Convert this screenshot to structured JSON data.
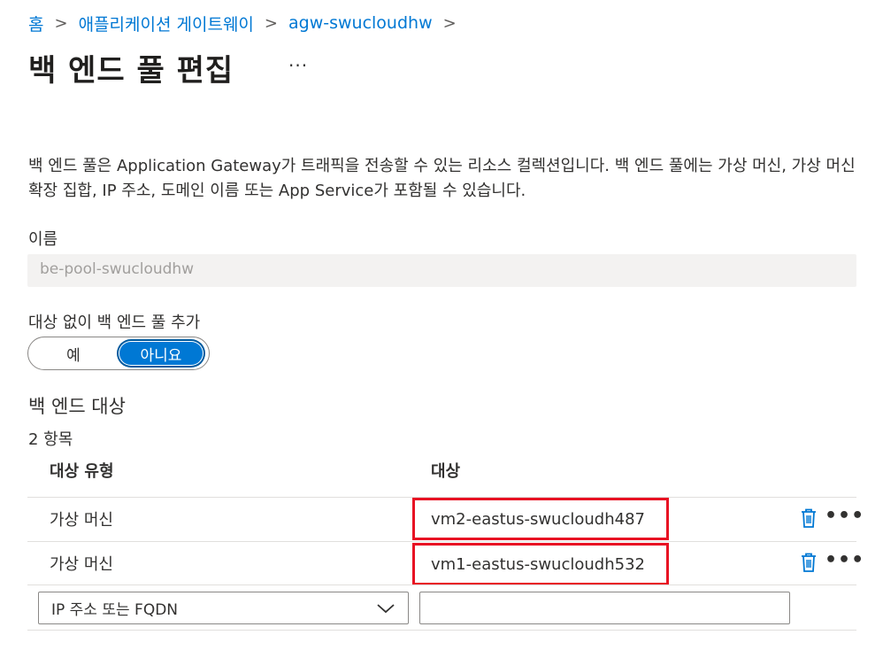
{
  "breadcrumb": {
    "items": [
      "홈",
      "애플리케이션 게이트웨이",
      "agw-swucloudhw"
    ],
    "separator": ">"
  },
  "page": {
    "title": "백 엔드 풀 편집",
    "more_label": "···"
  },
  "description": "백 엔드 풀은 Application Gateway가 트래픽을 전송할 수 있는 리소스 컬렉션입니다. 백 엔드 풀에는 가상 머신, 가상 머신 확장 집합, IP 주소, 도메인 이름 또는 App Service가 포함될 수 있습니다.",
  "name_field": {
    "label": "이름",
    "value": "be-pool-swucloudhw"
  },
  "add_without_targets": {
    "label": "대상 없이 백 엔드 풀 추가",
    "options": [
      "예",
      "아니요"
    ],
    "selected": "아니요"
  },
  "backend_targets": {
    "title": "백 엔드 대상",
    "count_label": "2 항목",
    "columns": [
      "대상 유형",
      "대상"
    ],
    "rows": [
      {
        "type": "가상 머신",
        "target": "vm2-eastus-swucloudh487"
      },
      {
        "type": "가상 머신",
        "target": "vm1-eastus-swucloudh532"
      }
    ],
    "row_actions": {
      "delete_icon": "trash-icon",
      "more_label": "•••"
    },
    "new_row": {
      "type_select_value": "IP 주소 또는 FQDN",
      "target_value": ""
    }
  },
  "colors": {
    "accent": "#0078d4",
    "highlight_border": "#e81123"
  }
}
